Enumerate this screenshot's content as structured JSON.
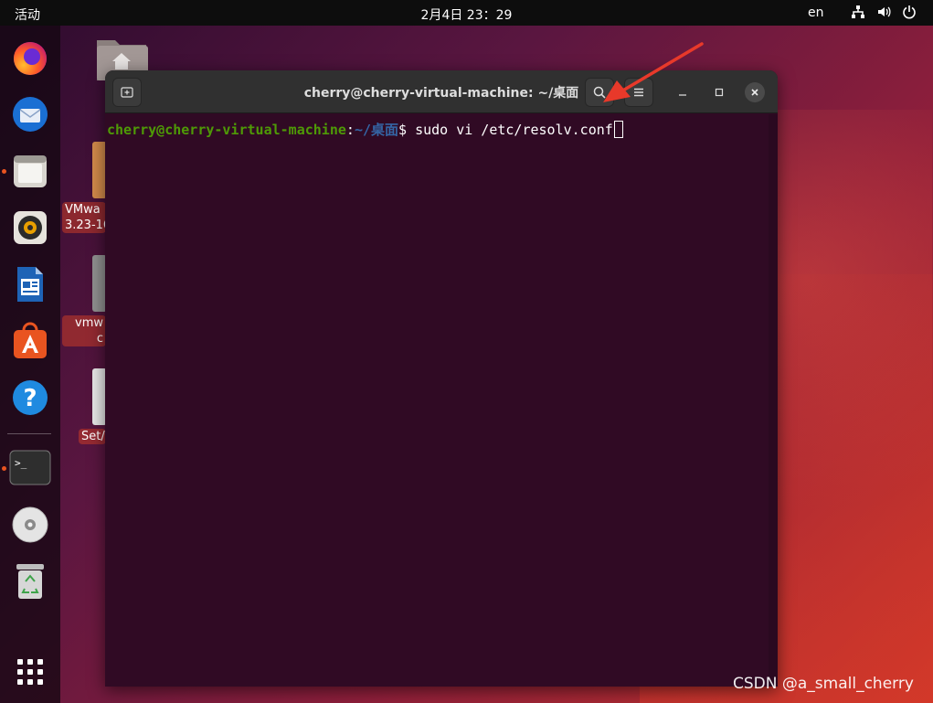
{
  "topbar": {
    "activities": "活动",
    "clock": "2月4日  23：29",
    "language": "en",
    "tray_icons": [
      "network-icon",
      "volume-icon",
      "power-icon"
    ]
  },
  "dock": {
    "apps": [
      {
        "name": "firefox",
        "running": false
      },
      {
        "name": "thunderbird",
        "running": false
      },
      {
        "name": "files",
        "running": true
      },
      {
        "name": "rhythmbox",
        "running": false
      },
      {
        "name": "libreoffice-writer",
        "running": false
      },
      {
        "name": "ubuntu-software",
        "running": false
      },
      {
        "name": "help",
        "running": false
      },
      {
        "name": "terminal",
        "running": true
      },
      {
        "name": "dvd-drive",
        "running": false
      },
      {
        "name": "trash",
        "running": false
      },
      {
        "name": "show-applications",
        "running": false
      }
    ]
  },
  "desktop": {
    "icons": [
      {
        "label_line1": "VMwa",
        "label_line2": "3.23-16"
      },
      {
        "label_line1": "vmw",
        "label_line2": "c"
      },
      {
        "label_line1": "Set/",
        "label_line2": ""
      }
    ]
  },
  "terminal": {
    "title": "cherry@cherry-virtual-machine: ~/桌面",
    "prompt_user": "cherry@cherry-virtual-machine",
    "prompt_sep": ":",
    "prompt_path": "~/桌面",
    "prompt_symbol": "$ ",
    "command": "sudo vi /etc/resolv.conf"
  },
  "watermark": "CSDN @a_small_cherry",
  "colors": {
    "terminal_bg": "#300a24",
    "prompt_user": "#4e9a06",
    "prompt_path": "#3465a4",
    "accent": "#e95420",
    "annotation_arrow": "#e8392a"
  }
}
